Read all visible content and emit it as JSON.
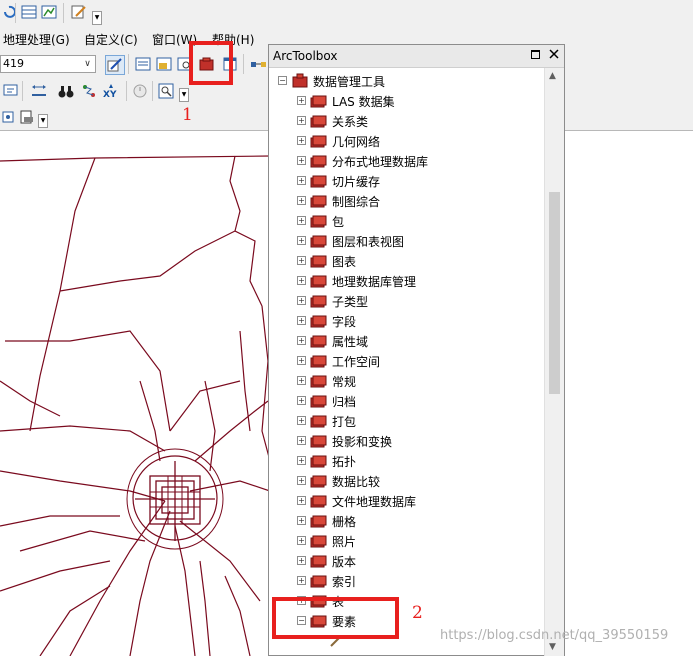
{
  "menubar": {
    "items": [
      {
        "label": "地理处理(G)"
      },
      {
        "label": "自定义(C)"
      },
      {
        "label": "窗口(W)"
      },
      {
        "label": "帮助(H)"
      }
    ]
  },
  "toolbar": {
    "scale_value": "419"
  },
  "toolbox": {
    "title": "ArcToolbox",
    "root": "数据管理工具",
    "items": [
      "LAS 数据集",
      "关系类",
      "几何网络",
      "分布式地理数据库",
      "切片缓存",
      "制图综合",
      "包",
      "图层和表视图",
      "图表",
      "地理数据库管理",
      "子类型",
      "字段",
      "属性域",
      "工作空间",
      "常规",
      "归档",
      "打包",
      "投影和变换",
      "拓扑",
      "数据比较",
      "文件地理数据库",
      "栅格",
      "照片",
      "版本",
      "索引",
      "表"
    ],
    "expanded_item": "要素"
  },
  "annotations": {
    "callout_1": "1",
    "callout_2": "2"
  },
  "watermark": "https://blog.csdn.net/qq_39550159",
  "colors": {
    "highlight": "#e8201e",
    "map_line": "#7a0a1e",
    "toolbar_bg": "#f0f0f0"
  }
}
